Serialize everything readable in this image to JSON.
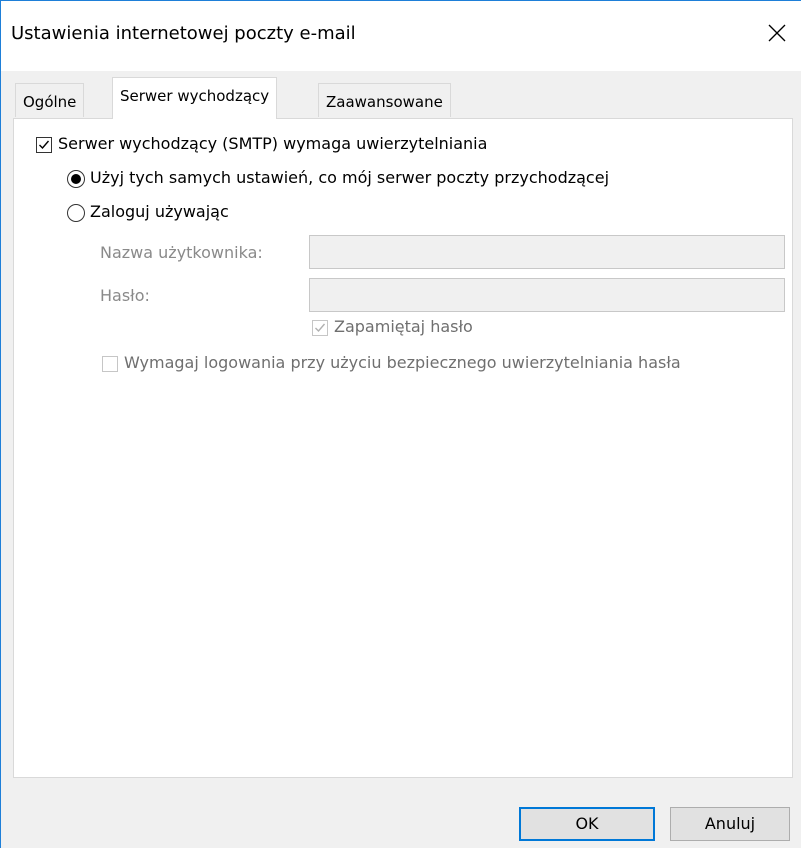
{
  "window": {
    "title": "Ustawienia internetowej poczty e-mail",
    "close_icon": "close-icon"
  },
  "tabs": [
    {
      "label": "Ogólne",
      "active": false
    },
    {
      "label": "Serwer wychodzący",
      "active": true
    },
    {
      "label": "Zaawansowane",
      "active": false
    }
  ],
  "outgoing": {
    "smtp_auth_label": "Serwer wychodzący (SMTP) wymaga uwierzytelniania",
    "smtp_auth_checked": true,
    "use_same_label": "Użyj tych samych ustawień, co mój serwer poczty przychodzącej",
    "use_same_selected": true,
    "login_using_label": "Zaloguj używając",
    "login_using_selected": false,
    "username_label": "Nazwa użytkownika:",
    "username_value": "",
    "password_label": "Hasło:",
    "password_value": "",
    "remember_password_label": "Zapamiętaj hasło",
    "remember_password_checked": true,
    "spa_label": "Wymagaj logowania przy użyciu bezpiecznego uwierzytelniania hasła",
    "spa_checked": false
  },
  "buttons": {
    "ok_label": "OK",
    "cancel_label": "Anuluj"
  },
  "colors": {
    "accent": "#0078d7",
    "window_border": "#1e7fd8",
    "disabled_text": "#8a8a8a"
  }
}
